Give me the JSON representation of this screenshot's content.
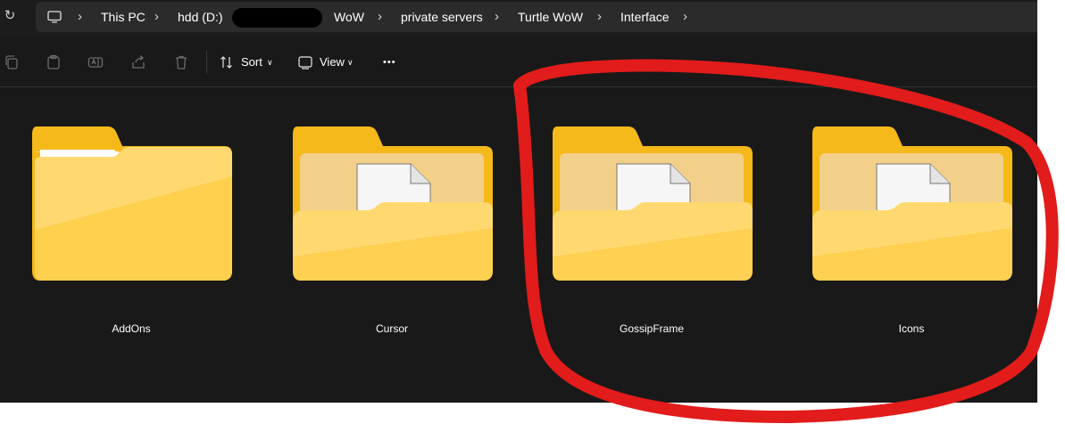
{
  "address_bar": {
    "refresh_icon": "refresh-icon",
    "computer_icon": "computer-icon",
    "breadcrumbs": [
      "This PC",
      "hdd (D:)",
      "WoW",
      "private servers",
      "Turtle WoW",
      "Interface"
    ],
    "separator": "›"
  },
  "toolbar": {
    "icons": [
      "copy-icon",
      "paste-icon",
      "rename-icon",
      "share-icon",
      "delete-icon"
    ],
    "sort_label": "Sort",
    "view_label": "View",
    "more_label": "•••"
  },
  "folders": [
    {
      "name": "AddOns",
      "variant": "plain"
    },
    {
      "name": "Cursor",
      "variant": "document"
    },
    {
      "name": "GossipFrame",
      "variant": "document"
    },
    {
      "name": "Icons",
      "variant": "document"
    }
  ],
  "colors": {
    "window_bg": "#191919",
    "folder_back": "#f5b919",
    "folder_front": "#ffd970",
    "annotation": "#e21b1b"
  }
}
